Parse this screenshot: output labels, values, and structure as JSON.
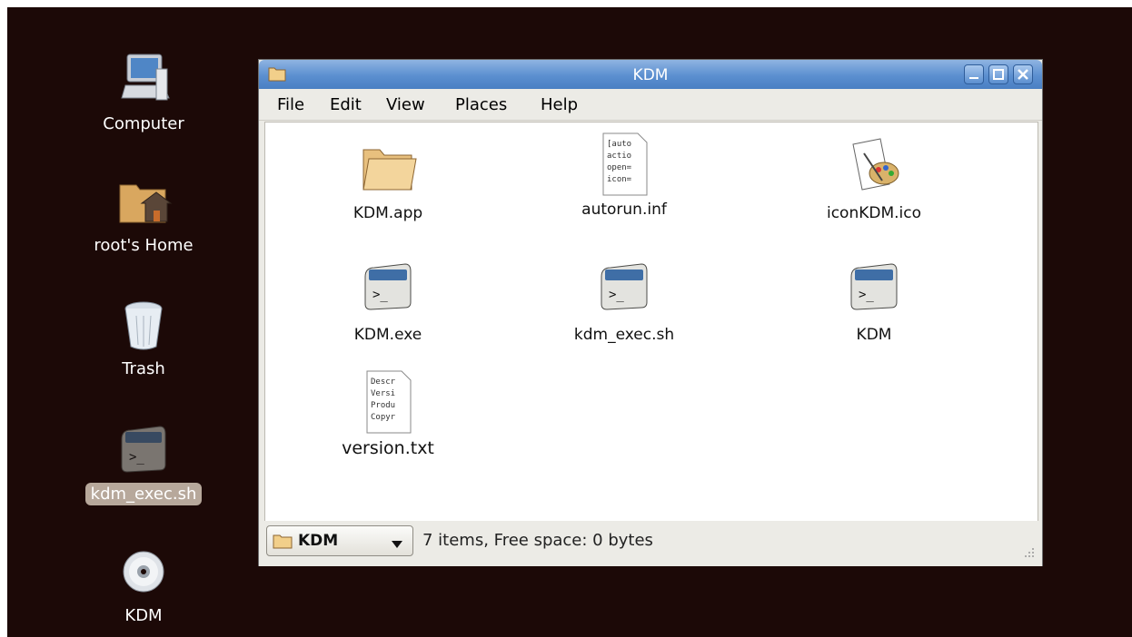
{
  "desktop": {
    "icons": [
      {
        "label": "Computer",
        "icon": "computer-icon"
      },
      {
        "label": "root's Home",
        "icon": "home-folder-icon"
      },
      {
        "label": "Trash",
        "icon": "trash-icon"
      },
      {
        "label": "kdm_exec.sh",
        "icon": "terminal-script-icon",
        "selected": true
      },
      {
        "label": "KDM",
        "icon": "cd-disc-icon"
      }
    ]
  },
  "window": {
    "title": "KDM",
    "title_icon": "folder-icon",
    "menu": [
      "File",
      "Edit",
      "View",
      "Places",
      "Help"
    ],
    "buttons": [
      "minimize",
      "maximize",
      "close"
    ],
    "files": [
      {
        "name": "KDM.app",
        "icon": "folder-icon"
      },
      {
        "name": "autorun.inf",
        "icon": "text-file-icon",
        "preview": [
          "[auto",
          "actio",
          "open=",
          "icon="
        ]
      },
      {
        "name": "iconKDM.ico",
        "icon": "image-file-icon"
      },
      {
        "name": "KDM.exe",
        "icon": "terminal-script-icon"
      },
      {
        "name": "kdm_exec.sh",
        "icon": "terminal-script-icon"
      },
      {
        "name": "KDM",
        "icon": "terminal-script-icon"
      },
      {
        "name": "version.txt",
        "icon": "text-file-icon",
        "preview": [
          "Descr",
          "Versi",
          "Produ",
          "Copyr"
        ]
      }
    ],
    "status": {
      "location": "KDM",
      "text": "7 items, Free space: 0 bytes"
    }
  },
  "colors": {
    "desktop_bg": "#1c0907",
    "titlebar": "#5b8fd0",
    "selection": "#b7a89b"
  }
}
